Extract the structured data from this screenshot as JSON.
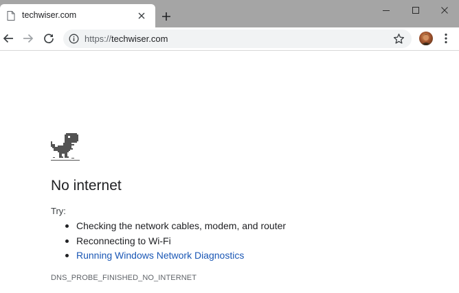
{
  "tab": {
    "title": "techwiser.com",
    "page_icon": "document-icon",
    "close_icon": "close-icon"
  },
  "new_tab_icon": "plus-icon",
  "window_controls": [
    "minimize-icon",
    "maximize-icon",
    "close-icon"
  ],
  "toolbar": {
    "back_icon": "arrow-left-icon",
    "forward_icon": "arrow-right-icon",
    "reload_icon": "reload-icon",
    "omnibox": {
      "info_icon": "info-icon",
      "url_scheme": "https://",
      "url_host": "techwiser.com",
      "star_icon": "star-outline-icon"
    },
    "profile_icon": "avatar",
    "menu_icon": "vertical-dots-icon"
  },
  "error": {
    "icon": "dinosaur-icon",
    "title": "No internet",
    "try_label": "Try:",
    "suggestions": [
      {
        "text": "Checking the network cables, modem, and router",
        "link": false
      },
      {
        "text": "Reconnecting to Wi-Fi",
        "link": false
      },
      {
        "text": "Running Windows Network Diagnostics",
        "link": true
      }
    ],
    "code": "DNS_PROBE_FINISHED_NO_INTERNET"
  },
  "colors": {
    "titlebar": "#a5a5a5",
    "omnibox": "#f1f3f4",
    "link": "#1a57b5",
    "text": "#202124"
  }
}
